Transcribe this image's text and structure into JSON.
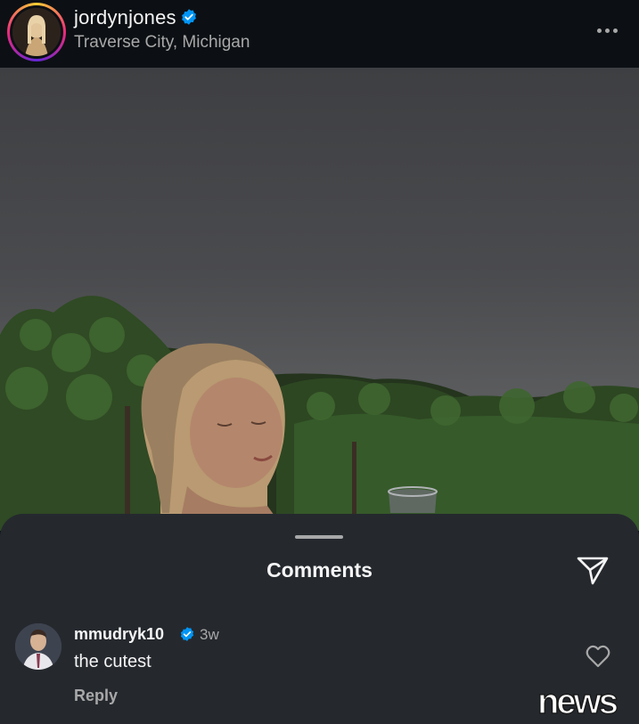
{
  "post": {
    "username": "jordynjones",
    "location": "Traverse City, Michigan"
  },
  "comments_sheet": {
    "title": "Comments",
    "comments": [
      {
        "username": "mmudryk10",
        "time": "3w",
        "text": "the cutest",
        "reply_label": "Reply"
      }
    ]
  },
  "watermark": {
    "text": "news"
  },
  "colors": {
    "verified_badge": "#0095f6",
    "sheet_background": "#25292e",
    "header_background": "#0c1014"
  },
  "icons": [
    "verified-badge-icon",
    "more-options-icon",
    "share-send-icon",
    "heart-icon"
  ]
}
